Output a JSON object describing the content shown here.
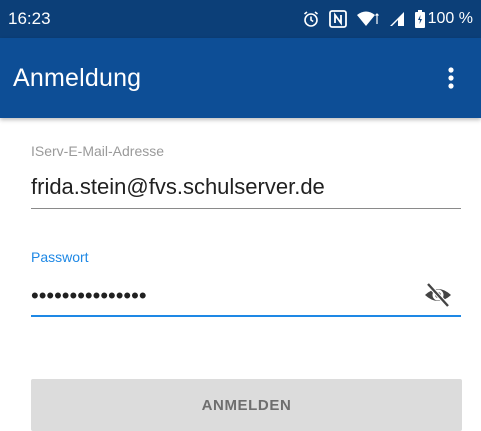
{
  "status_bar": {
    "time": "16:23",
    "icons": [
      "alarm-icon",
      "nfc-icon",
      "wifi-icon",
      "signal-icon",
      "battery-icon"
    ],
    "battery": "100 %"
  },
  "app_bar": {
    "title": "Anmeldung",
    "menu_icon": "overflow-menu-icon",
    "background": "#0d4e96"
  },
  "form": {
    "email": {
      "label": "IServ-E-Mail-Adresse",
      "value": "frida.stein@fvs.schulserver.de"
    },
    "password": {
      "label": "Passwort",
      "masked_value": "•••••••••••••••",
      "toggle_icon": "visibility-off-icon"
    },
    "submit_label": "ANMELDEN"
  },
  "colors": {
    "status_bar": "#0c3f78",
    "app_bar": "#0d4e96",
    "accent": "#1e88e5",
    "button_disabled": "#dcdcdc"
  }
}
